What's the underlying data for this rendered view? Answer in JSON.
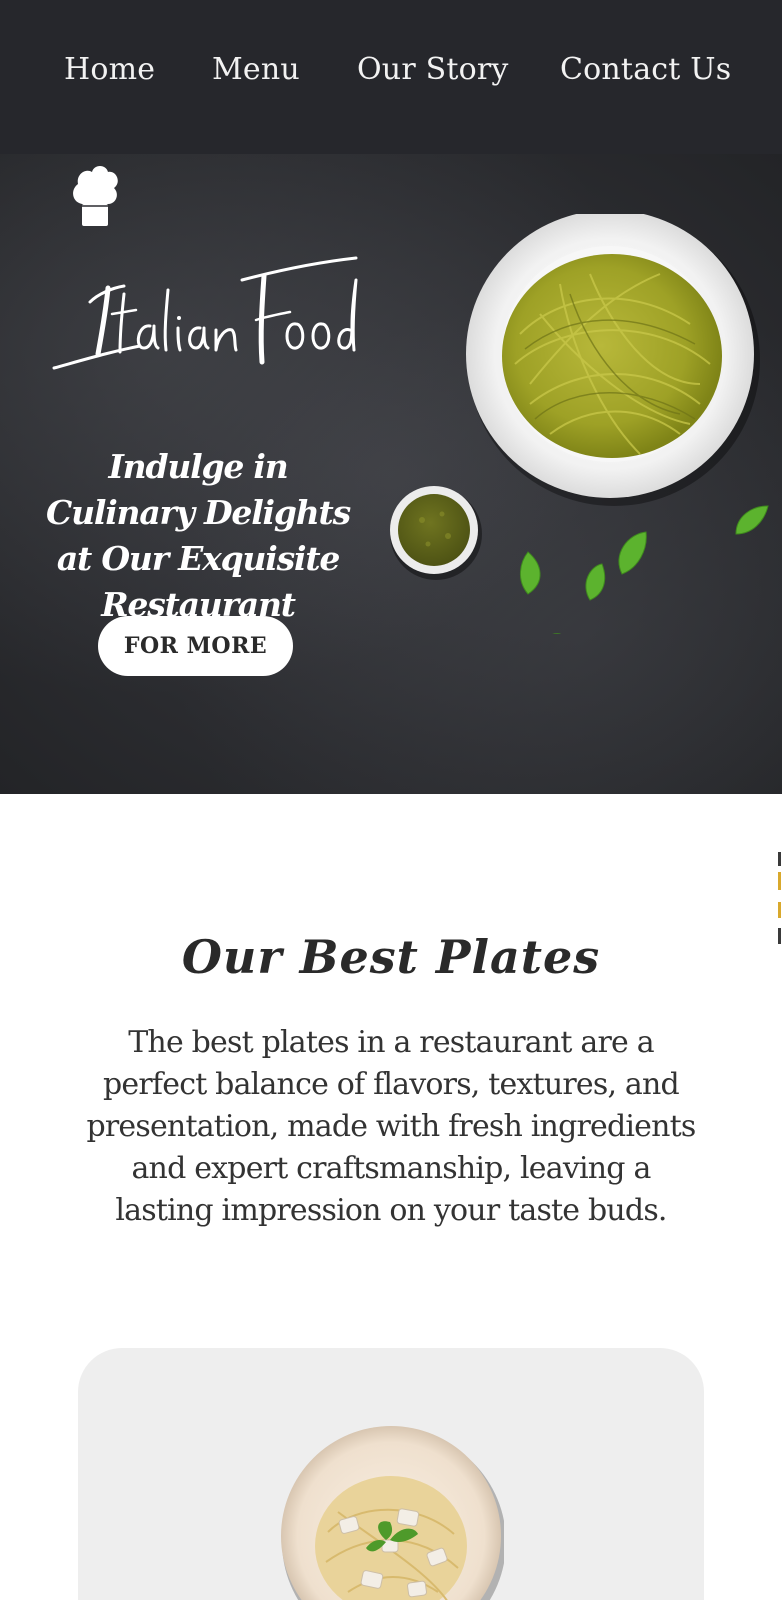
{
  "nav": {
    "items": [
      {
        "label": "Home"
      },
      {
        "label": "Menu"
      },
      {
        "label": "Our Story"
      },
      {
        "label": "Contact Us"
      }
    ]
  },
  "hero": {
    "logo_text": "Italian Food",
    "tagline": "Indulge in Culinary Delights at Our Exquisite Restaurant",
    "cta_label": "FOR MORE",
    "icon": "chef-hat-icon"
  },
  "plates": {
    "title": "Our Best Plates",
    "description": "The best plates in a restaurant are a perfect balance of flavors, textures, and presentation, made with fresh ingredients and expert craftsmanship, leaving a lasting impression on your taste buds."
  },
  "colors": {
    "nav_bg": "#26272c",
    "hero_bg": "#2b2c30",
    "cta_bg": "#ffffff",
    "card_bg": "#eeeeee",
    "pesto": "#9aa12c",
    "basil": "#5cb32e"
  }
}
